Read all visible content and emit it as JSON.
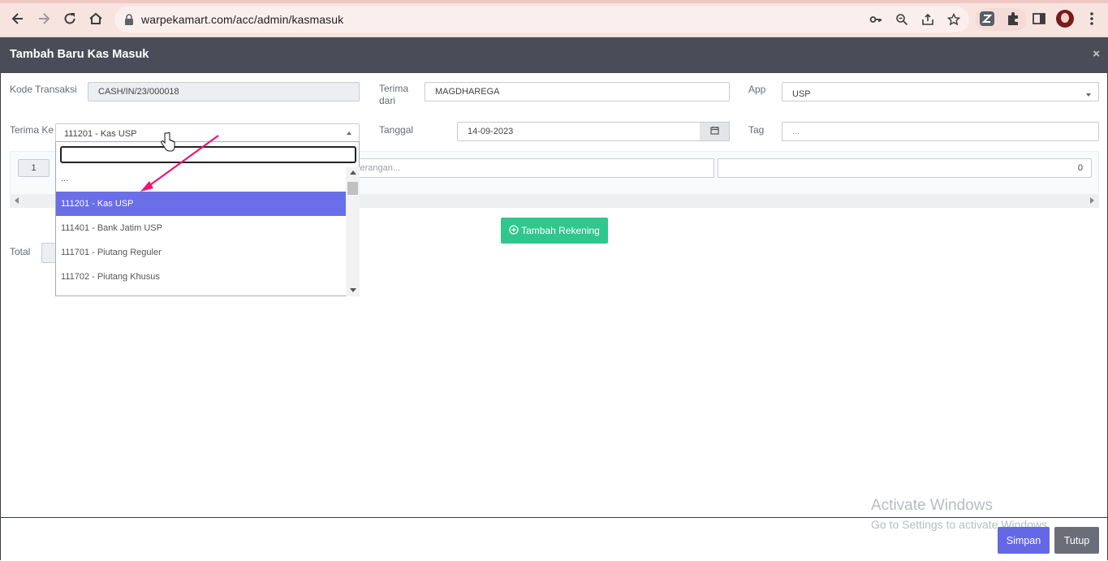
{
  "browser": {
    "url": "warpekamart.com/acc/admin/kasmasuk"
  },
  "modal": {
    "title": "Tambah Baru Kas Masuk",
    "close_glyph": "×"
  },
  "form": {
    "kode_transaksi_label": "Kode Transaksi",
    "kode_transaksi_value": "CASH/IN/23/000018",
    "terima_dari_label": "Terima dari",
    "terima_dari_value": "MAGDHAREGA",
    "app_label": "App",
    "app_value": "USP",
    "terima_ke_label": "Terima Ke",
    "terima_ke_value": "111201 - Kas USP",
    "tanggal_label": "Tanggal",
    "tanggal_value": "14-09-2023",
    "tag_label": "Tag",
    "tag_placeholder": "..."
  },
  "rekening_row": {
    "number": "1",
    "keterangan_placeholder": "Keterangan...",
    "amount": "0"
  },
  "buttons": {
    "tambah_rekening": "Tambah Rekening",
    "simpan": "Simpan",
    "tutup": "Tutup"
  },
  "total": {
    "label": "Total"
  },
  "dropdown": {
    "options": [
      {
        "label": "...",
        "selected": false
      },
      {
        "label": "111201 - Kas USP",
        "selected": true
      },
      {
        "label": "111401 - Bank Jatim USP",
        "selected": false
      },
      {
        "label": "111701 - Piutang Reguler",
        "selected": false
      },
      {
        "label": "111702 - Piutang Khusus",
        "selected": false
      }
    ]
  },
  "watermark": {
    "line1": "Activate Windows",
    "line2": "Go to Settings to activate Windows."
  },
  "colors": {
    "header_bg": "#4a4d57",
    "accent": "#6a6ee8",
    "success": "#30c78c",
    "annotation_arrow": "#e8177a"
  }
}
